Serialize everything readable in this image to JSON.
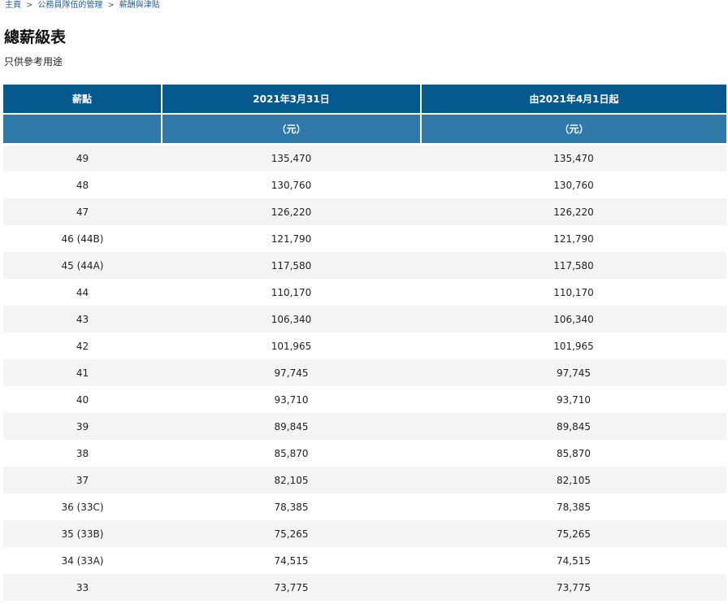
{
  "breadcrumb": {
    "items": [
      "主頁",
      "公務員隊伍的管理",
      "薪酬與津貼"
    ],
    "separator": ">"
  },
  "page": {
    "title": "總薪級表",
    "subtitle": "只供參考用途"
  },
  "table": {
    "headers": [
      "薪點",
      "2021年3月31日",
      "由2021年4月1日起"
    ],
    "subheaders": [
      "",
      "（元）",
      "（元）"
    ],
    "rows": [
      [
        "49",
        "135,470",
        "135,470"
      ],
      [
        "48",
        "130,760",
        "130,760"
      ],
      [
        "47",
        "126,220",
        "126,220"
      ],
      [
        "46 (44B)",
        "121,790",
        "121,790"
      ],
      [
        "45 (44A)",
        "117,580",
        "117,580"
      ],
      [
        "44",
        "110,170",
        "110,170"
      ],
      [
        "43",
        "106,340",
        "106,340"
      ],
      [
        "42",
        "101,965",
        "101,965"
      ],
      [
        "41",
        "97,745",
        "97,745"
      ],
      [
        "40",
        "93,710",
        "93,710"
      ],
      [
        "39",
        "89,845",
        "89,845"
      ],
      [
        "38",
        "85,870",
        "85,870"
      ],
      [
        "37",
        "82,105",
        "82,105"
      ],
      [
        "36 (33C)",
        "78,385",
        "78,385"
      ],
      [
        "35 (33B)",
        "75,265",
        "75,265"
      ],
      [
        "34 (33A)",
        "74,515",
        "74,515"
      ],
      [
        "33",
        "73,775",
        "73,775"
      ]
    ]
  },
  "colors": {
    "header_primary": "#045a8d",
    "header_secondary": "#2f7aaa",
    "link": "#1f5f99",
    "row_stripe": "#f4f4f4"
  }
}
